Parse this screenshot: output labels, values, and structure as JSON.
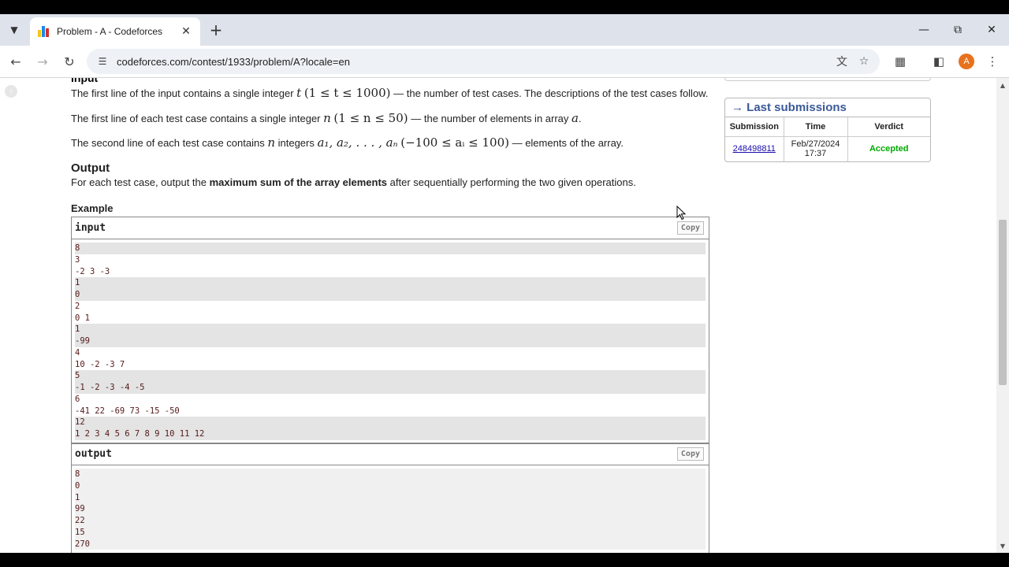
{
  "browser": {
    "tab_title": "Problem - A - Codeforces",
    "url": "codeforces.com/contest/1933/problem/A?locale=en",
    "avatar_letter": "A",
    "icons": {
      "tab_list": "chevron-down-icon",
      "close_tab": "close-icon",
      "new_tab": "plus-icon",
      "minimize": "minimize-icon",
      "restore": "restore-icon",
      "close_window": "close-icon",
      "back": "arrow-left-icon",
      "forward": "arrow-right-icon",
      "reload": "reload-icon",
      "site_info": "tune-icon",
      "translate": "translate-icon",
      "bookmark": "star-icon",
      "extensions": "puzzle-icon",
      "side_panel": "side-panel-icon",
      "menu": "kebab-menu-icon"
    }
  },
  "problem": {
    "input_heading": "Input",
    "input_line1_pre": "The first line of the input contains a single integer ",
    "input_line1_var": "t",
    "input_line1_math": "(1 ≤ t ≤ 1000)",
    "input_line1_post": " — the number of test cases. The descriptions of the test cases follow.",
    "input_line2_pre": "The first line of each test case contains a single integer ",
    "input_line2_var": "n",
    "input_line2_math": "(1 ≤ n ≤ 50)",
    "input_line2_mid": " — the number of elements in array ",
    "input_line2_var2": "a",
    "input_line2_post": ".",
    "input_line3_pre": "The second line of each test case contains ",
    "input_line3_var": "n",
    "input_line3_mid": " integers ",
    "input_line3_math1": "a₁, a₂, . . . , aₙ",
    "input_line3_math2": "(−100 ≤ aᵢ ≤ 100)",
    "input_line3_post": " — elements of the array.",
    "output_heading": "Output",
    "output_pre": "For each test case, output the ",
    "output_bold": "maximum sum of the array elements",
    "output_post": " after sequentially performing the two given operations.",
    "example_label": "Example",
    "input_label": "input",
    "output_label": "output",
    "copy_label": "Copy",
    "input_lines": [
      "8",
      "3",
      "-2 3 -3",
      "1",
      "0",
      "2",
      "0 1",
      "1",
      "-99",
      "4",
      "10 -2 -3 7",
      "5",
      "-1 -2 -3 -4 -5",
      "6",
      "-41 22 -69 73 -15 -50",
      "12",
      "1 2 3 4 5 6 7 8 9 10 11 12"
    ],
    "output_lines": [
      "8",
      "0",
      "1",
      "99",
      "22",
      "15",
      "270"
    ]
  },
  "sidebar": {
    "title": "→ Last submissions",
    "headers": [
      "Submission",
      "Time",
      "Verdict"
    ],
    "row": {
      "submission": "248498811",
      "time_date": "Feb/27/2024",
      "time_clock": "17:37",
      "verdict": "Accepted"
    },
    "colors": {
      "title": "#3b5998",
      "accepted": "#00aa00"
    }
  }
}
